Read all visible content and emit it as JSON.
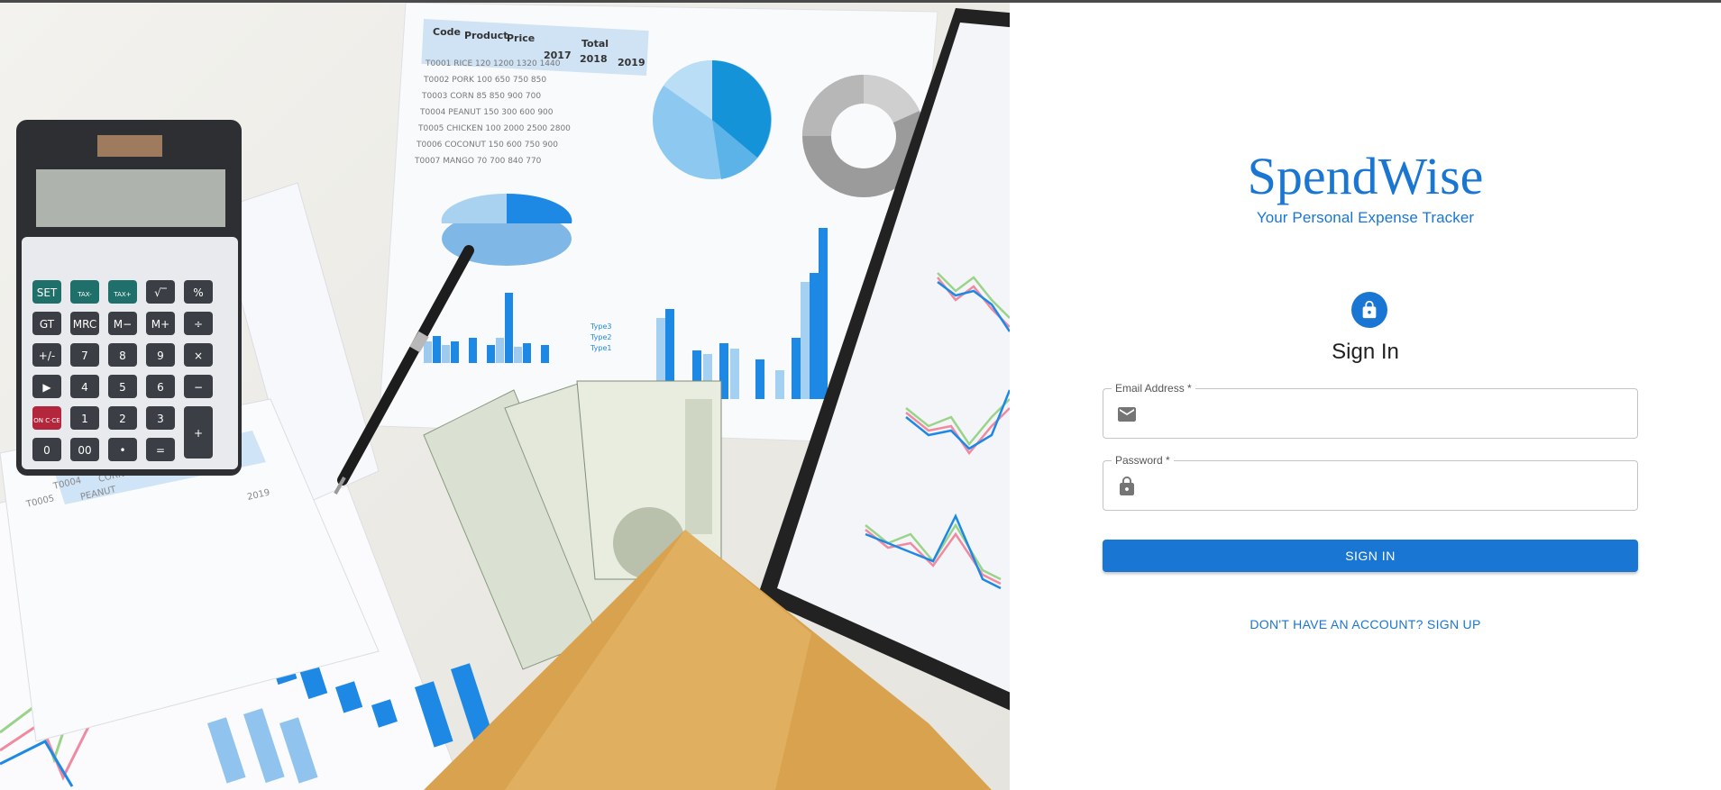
{
  "app": {
    "brand_name": "SpendWise",
    "tagline": "Your Personal Expense Tracker",
    "accent_color": "#1976d2"
  },
  "hero_image": {
    "description_icon": "finance-desk-photo",
    "calculator_keys": [
      "SET",
      "TAX-",
      "TAX+",
      "√‾",
      "%",
      "GT",
      "MRC",
      "M−",
      "M+",
      "÷",
      "+/-",
      "7",
      "8",
      "9",
      "×",
      "▶",
      "4",
      "5",
      "6",
      "−",
      "ON C·CE",
      "1",
      "2",
      "3",
      "+",
      "0",
      "00",
      "•",
      "="
    ],
    "table_header": [
      "Code",
      "Product",
      "Price",
      "Total"
    ],
    "table_years": [
      "2017",
      "2018",
      "2019"
    ],
    "table_rows": [
      [
        "T0001",
        "RICE",
        "120",
        "1200",
        "1320",
        "1440"
      ],
      [
        "T0002",
        "PORK",
        "100",
        "650",
        "750",
        "850"
      ],
      [
        "T0003",
        "CORN",
        "85",
        "850",
        "900",
        "700"
      ],
      [
        "T0004",
        "PEANUT",
        "150",
        "300",
        "600",
        "900"
      ],
      [
        "T0005",
        "CHICKEN",
        "100",
        "2000",
        "2500",
        "2800"
      ],
      [
        "T0006",
        "COCONUT",
        "150",
        "600",
        "750",
        "900"
      ],
      [
        "T0007",
        "MANGO",
        "70",
        "700",
        "840",
        "770"
      ]
    ],
    "legend_types": [
      "Type1",
      "Type2",
      "Type3"
    ]
  },
  "form": {
    "title": "Sign In",
    "lock_icon": "lock-icon",
    "email": {
      "label": "Email Address *",
      "value": "",
      "icon": "mail-icon"
    },
    "password": {
      "label": "Password *",
      "value": "",
      "icon": "lock-icon"
    },
    "submit_label": "SIGN IN",
    "signup_link": "DON'T HAVE AN ACCOUNT? SIGN UP"
  }
}
